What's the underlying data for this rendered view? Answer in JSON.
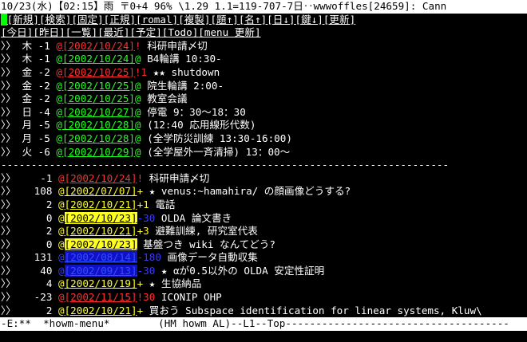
{
  "frame_title": "10/23(水)【02:15】雨 〒0+4 96% \\1.29 1.1=119-707-7日‥wwwoffles[24659]: Cann",
  "menu_row1": [
    "新規",
    "検索",
    "固定",
    "正規",
    "romal",
    "複製",
    "題↑",
    "名↑",
    "日↓",
    "鍵↓",
    "更新"
  ],
  "menu_row2": [
    "今日",
    "昨日",
    "一覧",
    "最近",
    "予定",
    "Todo",
    "menu 更新"
  ],
  "schedule": [
    {
      "prefix": "〉〉",
      "day": "木",
      "offset": "-1",
      "date": "2002/10/24",
      "mark": "!",
      "mark_color": "red",
      "date_color": "red",
      "text": "科研申請〆切"
    },
    {
      "prefix": "〉〉",
      "day": "木",
      "offset": "-1",
      "date": "2002/10/24",
      "mark": "@",
      "mark_color": "green",
      "date_color": "green",
      "text": "B4輪講 10:30-"
    },
    {
      "prefix": "〉〉",
      "day": "金",
      "offset": "-2",
      "date": "2002/10/25",
      "mark": "!1",
      "mark_color": "red",
      "date_color": "red",
      "text": "★★ shutdown"
    },
    {
      "prefix": "〉〉",
      "day": "金",
      "offset": "-2",
      "date": "2002/10/25",
      "mark": "@",
      "mark_color": "green",
      "date_color": "green",
      "text": "院生輪講 2:00-"
    },
    {
      "prefix": "〉〉",
      "day": "金",
      "offset": "-2",
      "date": "2002/10/25",
      "mark": "@",
      "mark_color": "green",
      "date_color": "green",
      "text": "教室会議"
    },
    {
      "prefix": "〉〉",
      "day": "日",
      "offset": "-4",
      "date": "2002/10/27",
      "mark": "@",
      "mark_color": "green",
      "date_color": "green",
      "text": "停電 9：30〜18：30"
    },
    {
      "prefix": "〉〉",
      "day": "月",
      "offset": "-5",
      "date": "2002/10/28",
      "mark": "@",
      "mark_color": "green",
      "date_color": "green",
      "text": "(12:40 応用線形代数)"
    },
    {
      "prefix": "〉〉",
      "day": "月",
      "offset": "-5",
      "date": "2002/10/28",
      "mark": "@",
      "mark_color": "green",
      "date_color": "green",
      "text": "(全学防災訓練 13:30-16:00)"
    },
    {
      "prefix": "〉〉",
      "day": "火",
      "offset": "-6",
      "date": "2002/10/29",
      "mark": "@",
      "mark_color": "green",
      "date_color": "green",
      "text": "(全学屋外一斉清掃) 13：00〜"
    }
  ],
  "separator": "--------------------------------------------------------------------------",
  "todo": [
    {
      "prefix": "〉〉",
      "priority": "-1",
      "date": "2002/10/24",
      "date_style": "red",
      "mark": "!",
      "mark_color": "red",
      "text": "科研申請〆切"
    },
    {
      "prefix": "〉〉",
      "priority": "108",
      "date": "2002/07/07",
      "date_style": "yellow",
      "mark": "+",
      "mark_color": "yellow",
      "text": "★ venus:~hamahira/ の顔画像どうする?"
    },
    {
      "prefix": "〉〉",
      "priority": "2",
      "date": "2002/10/21",
      "date_style": "yellow",
      "mark": "+1",
      "mark_color": "yellow",
      "text": "電話"
    },
    {
      "prefix": "〉〉",
      "priority": "0",
      "date": "2002/10/23",
      "date_style": "bg-yellow",
      "mark": "-30",
      "mark_color": "blue",
      "text": "OLDA 論文書き"
    },
    {
      "prefix": "〉〉",
      "priority": "2",
      "date": "2002/10/21",
      "date_style": "yellow",
      "mark": "+3",
      "mark_color": "yellow",
      "text": "避難訓練, 研究室代表"
    },
    {
      "prefix": "〉〉",
      "priority": "0",
      "date": "2002/10/23",
      "date_style": "bg-yellow",
      "mark": "",
      "mark_color": "white",
      "text": "基盤つき wiki なんてどう?"
    },
    {
      "prefix": "〉〉",
      "priority": "131",
      "date": "2002/08/14",
      "date_style": "bg-blue",
      "mark": "-180",
      "mark_color": "blue",
      "text": "画像データ自動収集"
    },
    {
      "prefix": "〉〉",
      "priority": "40",
      "date": "2002/09/13",
      "date_style": "bg-blue",
      "mark": "-30",
      "mark_color": "blue",
      "text": "★ αが0.5以外の OLDA 安定性証明"
    },
    {
      "prefix": "〉〉",
      "priority": "4",
      "date": "2002/10/19",
      "date_style": "yellow",
      "mark": "+",
      "mark_color": "yellow",
      "text": "★ 生協納品"
    },
    {
      "prefix": "〉〉",
      "priority": "-23",
      "date": "2002/11/15",
      "date_style": "red",
      "mark": "!30",
      "mark_color": "red",
      "text": "ICONIP OHP"
    },
    {
      "prefix": "〉〉",
      "priority": "2",
      "date": "2002/10/21",
      "date_style": "yellow",
      "mark": "+",
      "mark_color": "yellow",
      "text": "買おう Subspace identification for linear systems, Kluw\\"
    }
  ],
  "modeline": "-E:**  *howm-menu*        (HM howm AL)--L1--Top-------------------------------------"
}
